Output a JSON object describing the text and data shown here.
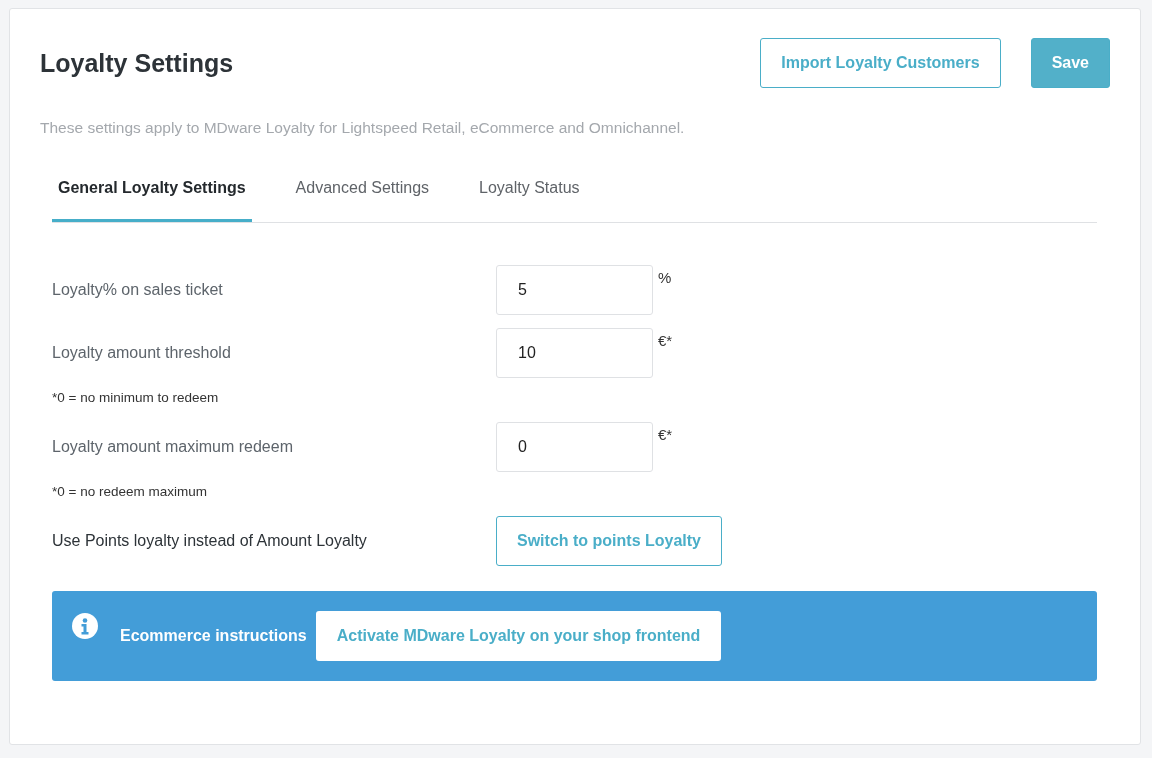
{
  "header": {
    "title": "Loyalty Settings",
    "buttons": [
      {
        "label": "Import Loyalty Customers",
        "kind": "outline"
      },
      {
        "label": "Save",
        "kind": "primary"
      }
    ]
  },
  "description": "These settings apply to MDware Loyalty for Lightspeed Retail, eCommerce and Omnichannel.",
  "tabs": [
    {
      "label": "General Loyalty Settings",
      "selected": true
    },
    {
      "label": "Advanced Settings",
      "selected": false
    },
    {
      "label": "Loyalty Status",
      "selected": false
    }
  ],
  "settings": [
    {
      "kind": "input",
      "label": "Loyalty% on sales ticket",
      "value": "5",
      "unit": "%"
    },
    {
      "kind": "input",
      "label": "Loyalty amount threshold",
      "value": "10",
      "unit": "€*",
      "note": "*0 = no minimum to redeem"
    },
    {
      "kind": "input",
      "label": "Loyalty amount maximum redeem",
      "value": "0",
      "unit": "€*",
      "note": "*0 = no redeem maximum"
    },
    {
      "kind": "button",
      "label": "Use Points loyalty instead of Amount Loyalty",
      "button": "Switch to points Loyalty"
    }
  ],
  "banner": {
    "title": "Ecommerce instructions",
    "button": "Activate MDware Loyalty on your shop frontend"
  }
}
